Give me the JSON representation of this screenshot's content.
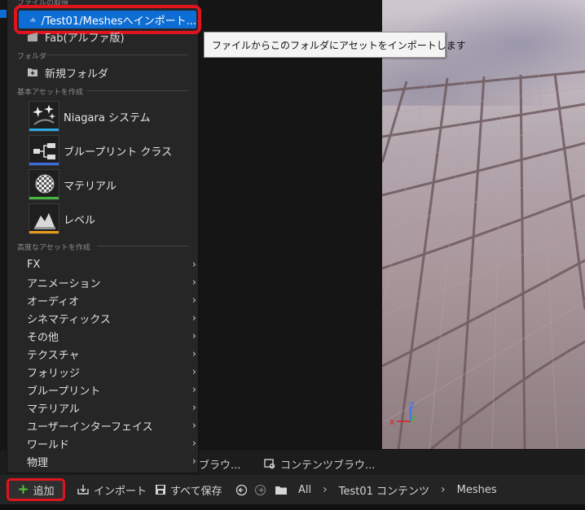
{
  "menu": {
    "top_section": "ファイルの取得",
    "import_label": "/Test01/Meshesへインポート...",
    "fab_label": "Fab(アルファ版)",
    "folder_section": "フォルダ",
    "new_folder": "新規フォルダ",
    "basic_section": "基本アセットを作成",
    "assets": [
      {
        "label": "Niagara システム",
        "icon": "niagara-icon",
        "color": "#2aa8e6"
      },
      {
        "label": "ブループリント クラス",
        "icon": "blueprint-class-icon",
        "color": "#3c6ee0"
      },
      {
        "label": "マテリアル",
        "icon": "material-icon",
        "color": "#47b63f"
      },
      {
        "label": "レベル",
        "icon": "level-icon",
        "color": "#e89a1a"
      }
    ],
    "advanced_section": "高度なアセットを作成",
    "submenus": [
      "FX",
      "アニメーション",
      "オーディオ",
      "シネマティックス",
      "その他",
      "テクスチャ",
      "フォリッジ",
      "ブループリント",
      "マテリアル",
      "ユーザーインターフェイス",
      "ワールド",
      "物理"
    ]
  },
  "tooltip": "ファイルからこのフォルダにアセットをインポートします",
  "tabs": {
    "tab1": "ブラウ...",
    "tab2": "コンテンツブラウ..."
  },
  "toolbar": {
    "add": "追加",
    "import": "インポート",
    "save_all": "すべて保存",
    "crumb_all": "All",
    "crumb_content": "Test01 コンテンツ",
    "crumb_meshes": "Meshes"
  },
  "gizmo": {
    "x": "x",
    "z": "Z"
  },
  "colors": {
    "highlight": "#0e6dd4",
    "callout": "#e0141f",
    "add_plus": "#53c23a"
  }
}
